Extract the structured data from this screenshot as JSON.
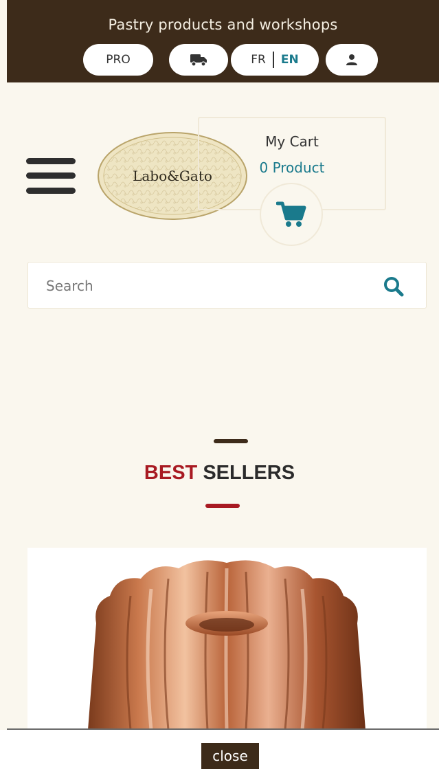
{
  "topbar": {
    "tagline": "Pastry products and workshops",
    "pro_label": "PRO",
    "lang_fr": "FR",
    "lang_en": "EN"
  },
  "logo": {
    "text": "Labo&Gato"
  },
  "cart": {
    "title": "My Cart",
    "count": "0 Product"
  },
  "search": {
    "placeholder": "Search"
  },
  "best_sellers": {
    "word1": "BEST",
    "word2": "SELLERS"
  },
  "footer": {
    "close_label": "close"
  },
  "colors": {
    "topbar_bg": "#3d2b1a",
    "accent_teal": "#1a7a8c",
    "accent_red": "#a81a22",
    "page_bg": "#faf7ee"
  },
  "icons": [
    "hamburger-menu-icon",
    "truck-icon",
    "user-icon",
    "cart-icon",
    "search-icon"
  ]
}
